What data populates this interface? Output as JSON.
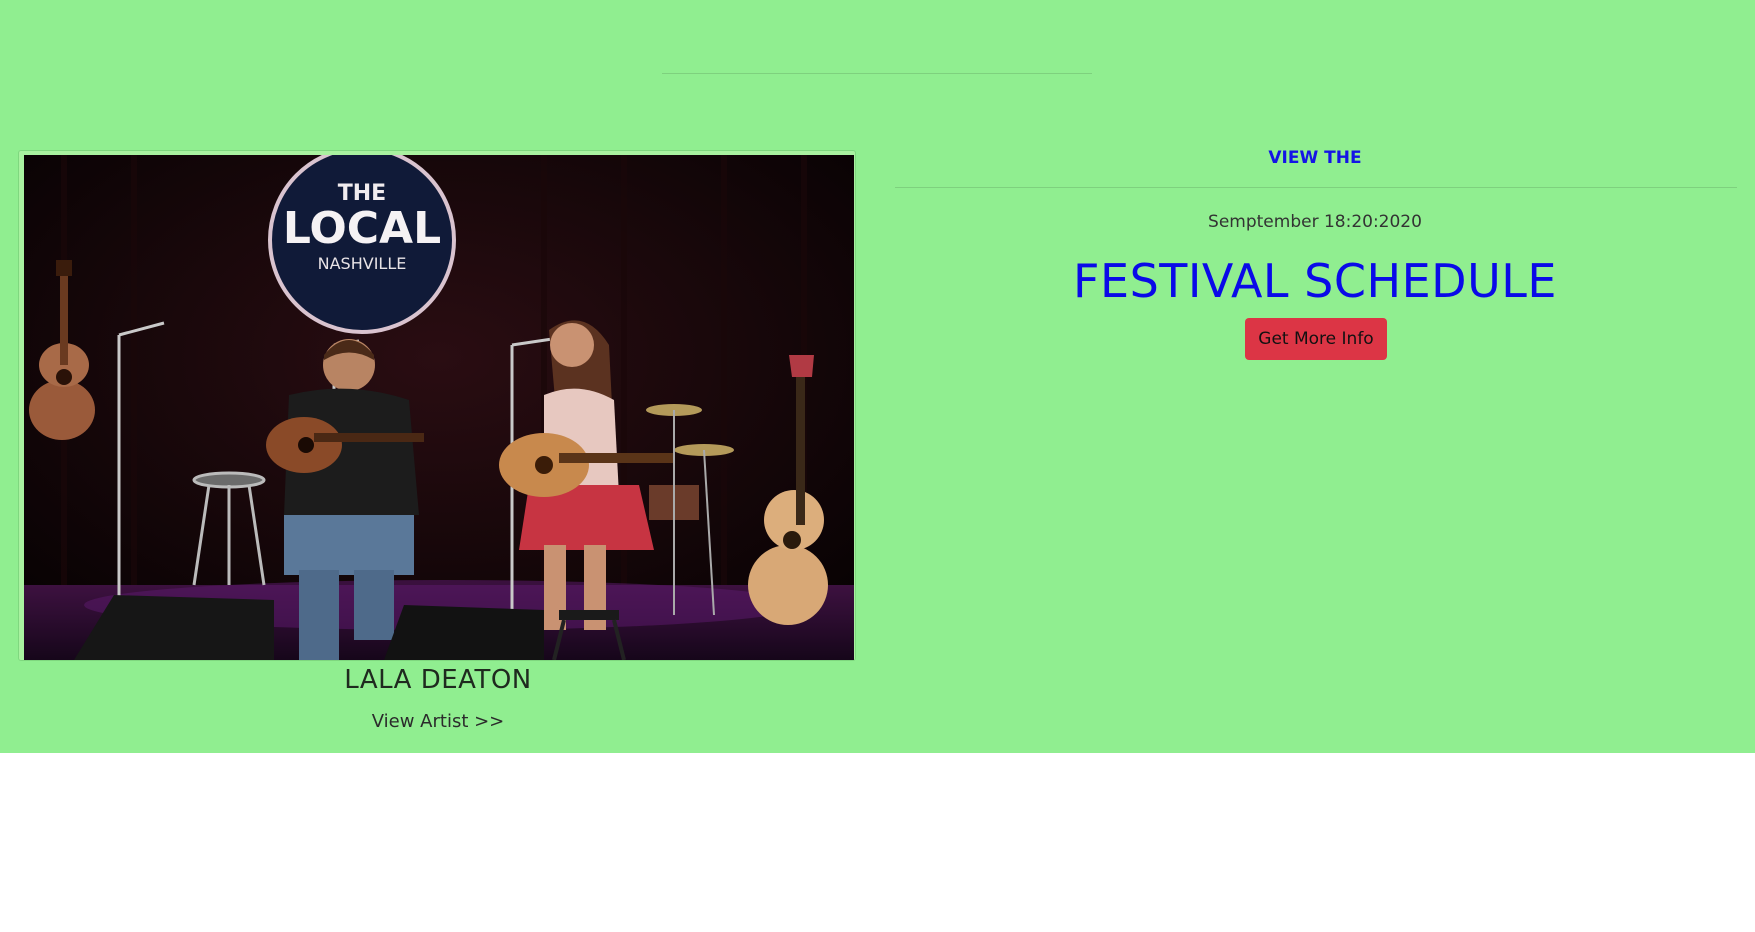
{
  "artist": {
    "name": "LALA DEATON",
    "link_label": "View Artist >>",
    "photo_alt": "Two musicians performing on stage"
  },
  "schedule": {
    "eyebrow": "VIEW THE",
    "date": "Semptember 18:20:2020",
    "title": "FESTIVAL SCHEDULE",
    "button_label": "Get More Info"
  },
  "colors": {
    "background": "#90ee90",
    "accent_blue": "#0a0ae8",
    "button_red": "#dc3545"
  }
}
